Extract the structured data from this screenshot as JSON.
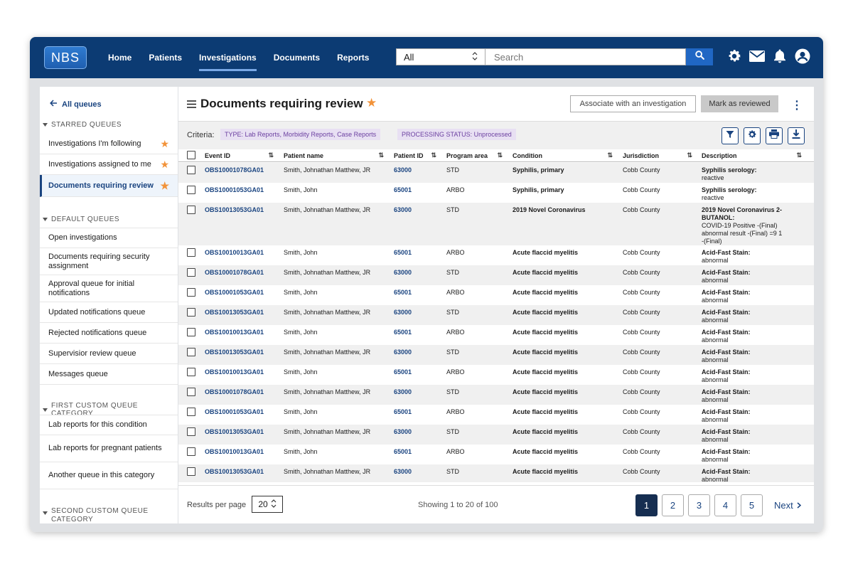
{
  "app": {
    "logo": "NBS"
  },
  "nav": [
    {
      "label": "Home"
    },
    {
      "label": "Patients"
    },
    {
      "label": "Investigations",
      "active": true
    },
    {
      "label": "Documents"
    },
    {
      "label": "Reports"
    }
  ],
  "search": {
    "scope": "All",
    "placeholder": "Search"
  },
  "header_icons": [
    "gear-icon",
    "mail-icon",
    "bell-icon",
    "user-icon"
  ],
  "sidebar": {
    "back": "All queues",
    "sections": [
      {
        "title": "STARRED QUEUES",
        "items": [
          {
            "label": "Investigations I'm following",
            "starred": true
          },
          {
            "label": "Investigations assigned to me",
            "starred": true
          },
          {
            "label": "Documents requiring review",
            "starred": true,
            "active": true
          }
        ]
      },
      {
        "title": "DEFAULT QUEUES",
        "items": [
          {
            "label": "Open investigations"
          },
          {
            "label": "Documents requiring security assignment"
          },
          {
            "label": "Approval queue for initial notifications"
          },
          {
            "label": "Updated notifications queue"
          },
          {
            "label": "Rejected notifications queue"
          },
          {
            "label": "Supervisior review queue"
          },
          {
            "label": "Messages queue"
          }
        ]
      },
      {
        "title": "FIRST CUSTOM QUEUE CATEGORY",
        "items": [
          {
            "label": "Lab reports for this condition"
          },
          {
            "label": "Lab reports for pregnant patients"
          },
          {
            "label": "Another queue in this category"
          }
        ]
      },
      {
        "title": "SECOND CUSTOM QUEUE CATEGORY",
        "items": []
      }
    ]
  },
  "page": {
    "title": "Documents requiring review",
    "associate_btn": "Associate with an investigation",
    "reviewed_btn": "Mark as reviewed",
    "criteria_label": "Criteria:",
    "criteria": [
      "TYPE: Lab Reports, Morbidity Reports, Case Reports",
      "PROCESSING STATUS: Unprocessed"
    ]
  },
  "table": {
    "columns": [
      "Event ID",
      "Patient name",
      "Patient ID",
      "Program area",
      "Condition",
      "Jurisdiction",
      "Description"
    ],
    "rows": [
      {
        "event": "OBS10001078GA01",
        "patient": "Smith, Johnathan Matthew, JR",
        "pid": "63000",
        "program": "STD",
        "condition": "Syphilis, primary",
        "jurisdiction": "Cobb County",
        "desc_title": "Syphilis serology:",
        "desc_body": "reactive"
      },
      {
        "event": "OBS10001053GA01",
        "patient": "Smith, John",
        "pid": "65001",
        "program": "ARBO",
        "condition": "Syphilis, primary",
        "jurisdiction": "Cobb County",
        "desc_title": "Syphilis serology:",
        "desc_body": "reactive"
      },
      {
        "event": "OBS10013053GA01",
        "patient": "Smith, Johnathan Matthew, JR",
        "pid": "63000",
        "program": "STD",
        "condition": "2019 Novel Coronavirus",
        "jurisdiction": "Cobb County",
        "desc_title": "2019 Novel Coronavirus 2-BUTANOL:",
        "desc_body": "COVID-19 Positive -(Final) abnormal result -(Final) =9 1 -(Final)"
      },
      {
        "event": "OBS10010013GA01",
        "patient": "Smith, John",
        "pid": "65001",
        "program": "ARBO",
        "condition": "Acute flaccid myelitis",
        "jurisdiction": "Cobb County",
        "desc_title": "Acid-Fast Stain:",
        "desc_body": "abnormal"
      },
      {
        "event": "OBS10001078GA01",
        "patient": "Smith, Johnathan Matthew, JR",
        "pid": "63000",
        "program": "STD",
        "condition": "Acute flaccid myelitis",
        "jurisdiction": "Cobb County",
        "desc_title": "Acid-Fast Stain:",
        "desc_body": "abnormal"
      },
      {
        "event": "OBS10001053GA01",
        "patient": "Smith, John",
        "pid": "65001",
        "program": "ARBO",
        "condition": "Acute flaccid myelitis",
        "jurisdiction": "Cobb County",
        "desc_title": "Acid-Fast Stain:",
        "desc_body": "abnormal"
      },
      {
        "event": "OBS10013053GA01",
        "patient": "Smith, Johnathan Matthew, JR",
        "pid": "63000",
        "program": "STD",
        "condition": "Acute flaccid myelitis",
        "jurisdiction": "Cobb County",
        "desc_title": "Acid-Fast Stain:",
        "desc_body": "abnormal"
      },
      {
        "event": "OBS10010013GA01",
        "patient": "Smith, John",
        "pid": "65001",
        "program": "ARBO",
        "condition": "Acute flaccid myelitis",
        "jurisdiction": "Cobb County",
        "desc_title": "Acid-Fast Stain:",
        "desc_body": "abnormal"
      },
      {
        "event": "OBS10013053GA01",
        "patient": "Smith, Johnathan Matthew, JR",
        "pid": "63000",
        "program": "STD",
        "condition": "Acute flaccid myelitis",
        "jurisdiction": "Cobb County",
        "desc_title": "Acid-Fast Stain:",
        "desc_body": "abnormal"
      },
      {
        "event": "OBS10010013GA01",
        "patient": "Smith, John",
        "pid": "65001",
        "program": "ARBO",
        "condition": "Acute flaccid myelitis",
        "jurisdiction": "Cobb County",
        "desc_title": "Acid-Fast Stain:",
        "desc_body": "abnormal"
      },
      {
        "event": "OBS10001078GA01",
        "patient": "Smith, Johnathan Matthew, JR",
        "pid": "63000",
        "program": "STD",
        "condition": "Acute flaccid myelitis",
        "jurisdiction": "Cobb County",
        "desc_title": "Acid-Fast Stain:",
        "desc_body": "abnormal"
      },
      {
        "event": "OBS10001053GA01",
        "patient": "Smith, John",
        "pid": "65001",
        "program": "ARBO",
        "condition": "Acute flaccid myelitis",
        "jurisdiction": "Cobb County",
        "desc_title": "Acid-Fast Stain:",
        "desc_body": "abnormal"
      },
      {
        "event": "OBS10013053GA01",
        "patient": "Smith, Johnathan Matthew, JR",
        "pid": "63000",
        "program": "STD",
        "condition": "Acute flaccid myelitis",
        "jurisdiction": "Cobb County",
        "desc_title": "Acid-Fast Stain:",
        "desc_body": "abnormal"
      },
      {
        "event": "OBS10010013GA01",
        "patient": "Smith, John",
        "pid": "65001",
        "program": "ARBO",
        "condition": "Acute flaccid myelitis",
        "jurisdiction": "Cobb County",
        "desc_title": "Acid-Fast Stain:",
        "desc_body": "abnormal"
      },
      {
        "event": "OBS10013053GA01",
        "patient": "Smith, Johnathan Matthew, JR",
        "pid": "63000",
        "program": "STD",
        "condition": "Acute flaccid myelitis",
        "jurisdiction": "Cobb County",
        "desc_title": "Acid-Fast Stain:",
        "desc_body": "abnormal"
      }
    ]
  },
  "footer": {
    "rpp_label": "Results per page",
    "rpp_value": "20",
    "showing": "Showing 1 to 20 of  100",
    "pages": [
      "1",
      "2",
      "3",
      "4",
      "5"
    ],
    "current_page": "1",
    "next": "Next"
  },
  "colors": {
    "header": "#0c3b73",
    "link": "#1a4480",
    "star": "#f2933a",
    "chip_bg": "#e8e0f3",
    "chip_text": "#6b3fa0"
  }
}
